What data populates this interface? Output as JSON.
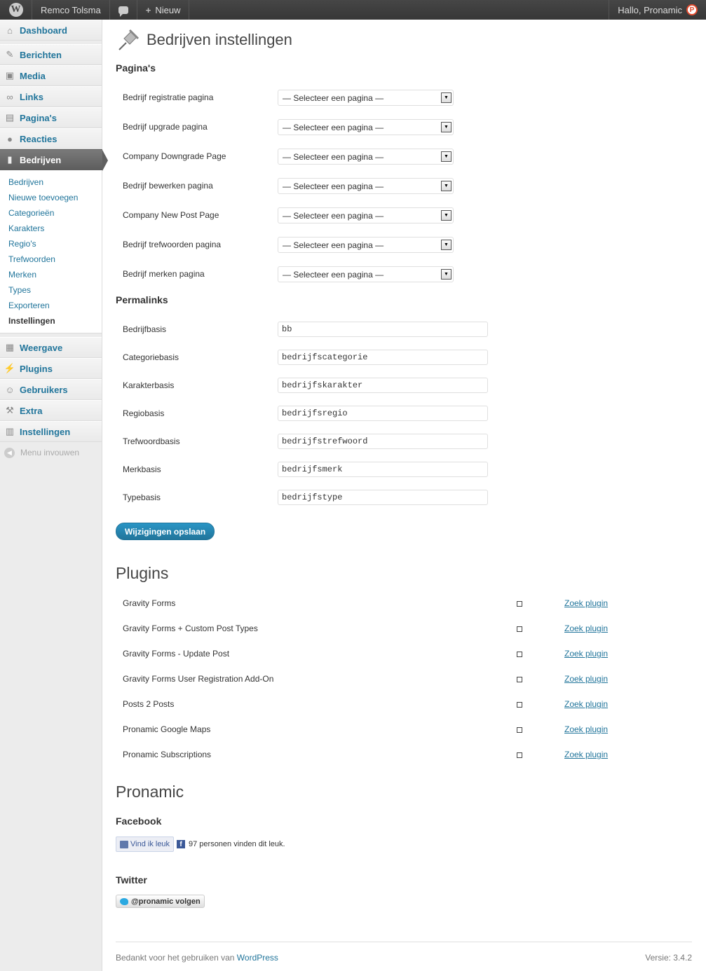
{
  "adminbar": {
    "site_name": "Remco Tolsma",
    "new_label": "Nieuw",
    "greeting": "Hallo, Pronamic"
  },
  "sidebar": {
    "top_items": [
      {
        "label": "Dashboard",
        "icon": "dashboard-icon"
      },
      {
        "label": "Berichten",
        "icon": "pin-icon"
      },
      {
        "label": "Media",
        "icon": "media-icon"
      },
      {
        "label": "Links",
        "icon": "links-icon"
      },
      {
        "label": "Pagina's",
        "icon": "pages-icon"
      },
      {
        "label": "Reacties",
        "icon": "comments-icon"
      },
      {
        "label": "Bedrijven",
        "icon": "companies-icon"
      }
    ],
    "submenu": [
      "Bedrijven",
      "Nieuwe toevoegen",
      "Categorieën",
      "Karakters",
      "Regio's",
      "Trefwoorden",
      "Merken",
      "Types",
      "Exporteren",
      "Instellingen"
    ],
    "bottom_items": [
      {
        "label": "Weergave",
        "icon": "appearance-icon"
      },
      {
        "label": "Plugins",
        "icon": "plugins-icon"
      },
      {
        "label": "Gebruikers",
        "icon": "users-icon"
      },
      {
        "label": "Extra",
        "icon": "tools-icon"
      },
      {
        "label": "Instellingen",
        "icon": "settings-icon"
      }
    ],
    "collapse_label": "Menu invouwen"
  },
  "main": {
    "title": "Bedrijven instellingen",
    "pages_heading": "Pagina's",
    "page_rows": [
      {
        "label": "Bedrijf registratie pagina",
        "value": "— Selecteer een pagina —"
      },
      {
        "label": "Bedrijf upgrade pagina",
        "value": "— Selecteer een pagina —"
      },
      {
        "label": "Company Downgrade Page",
        "value": "— Selecteer een pagina —"
      },
      {
        "label": "Bedrijf bewerken pagina",
        "value": "— Selecteer een pagina —"
      },
      {
        "label": "Company New Post Page",
        "value": "— Selecteer een pagina —"
      },
      {
        "label": "Bedrijf trefwoorden pagina",
        "value": "— Selecteer een pagina —"
      },
      {
        "label": "Bedrijf merken pagina",
        "value": "— Selecteer een pagina —"
      }
    ],
    "permalinks_heading": "Permalinks",
    "permalink_rows": [
      {
        "label": "Bedrijfbasis",
        "value": "bb"
      },
      {
        "label": "Categoriebasis",
        "value": "bedrijfscategorie"
      },
      {
        "label": "Karakterbasis",
        "value": "bedrijfskarakter"
      },
      {
        "label": "Regiobasis",
        "value": "bedrijfsregio"
      },
      {
        "label": "Trefwoordbasis",
        "value": "bedrijfstrefwoord"
      },
      {
        "label": "Merkbasis",
        "value": "bedrijfsmerk"
      },
      {
        "label": "Typebasis",
        "value": "bedrijfstype"
      }
    ],
    "save_label": "Wijzigingen opslaan",
    "plugins_heading": "Plugins",
    "plugins": [
      {
        "name": "Gravity Forms",
        "link": "Zoek plugin"
      },
      {
        "name": "Gravity Forms + Custom Post Types",
        "link": "Zoek plugin"
      },
      {
        "name": "Gravity Forms - Update Post",
        "link": "Zoek plugin"
      },
      {
        "name": "Gravity Forms User Registration Add-On",
        "link": "Zoek plugin"
      },
      {
        "name": "Posts 2 Posts",
        "link": "Zoek plugin"
      },
      {
        "name": "Pronamic Google Maps",
        "link": "Zoek plugin"
      },
      {
        "name": "Pronamic Subscriptions",
        "link": "Zoek plugin"
      }
    ],
    "pronamic_heading": "Pronamic",
    "facebook_heading": "Facebook",
    "facebook_like": "Vind ik leuk",
    "facebook_count": "97 personen vinden dit leuk.",
    "twitter_heading": "Twitter",
    "twitter_follow": "@pronamic volgen"
  },
  "footer": {
    "thanks": "Bedankt voor het gebruiken van",
    "wp_link": "WordPress",
    "version": "Versie: 3.4.2"
  },
  "colors": {
    "link": "#21759b",
    "primary_button": "#21759b",
    "current_menu": "#6d6d6d",
    "adminbar": "#464646"
  }
}
